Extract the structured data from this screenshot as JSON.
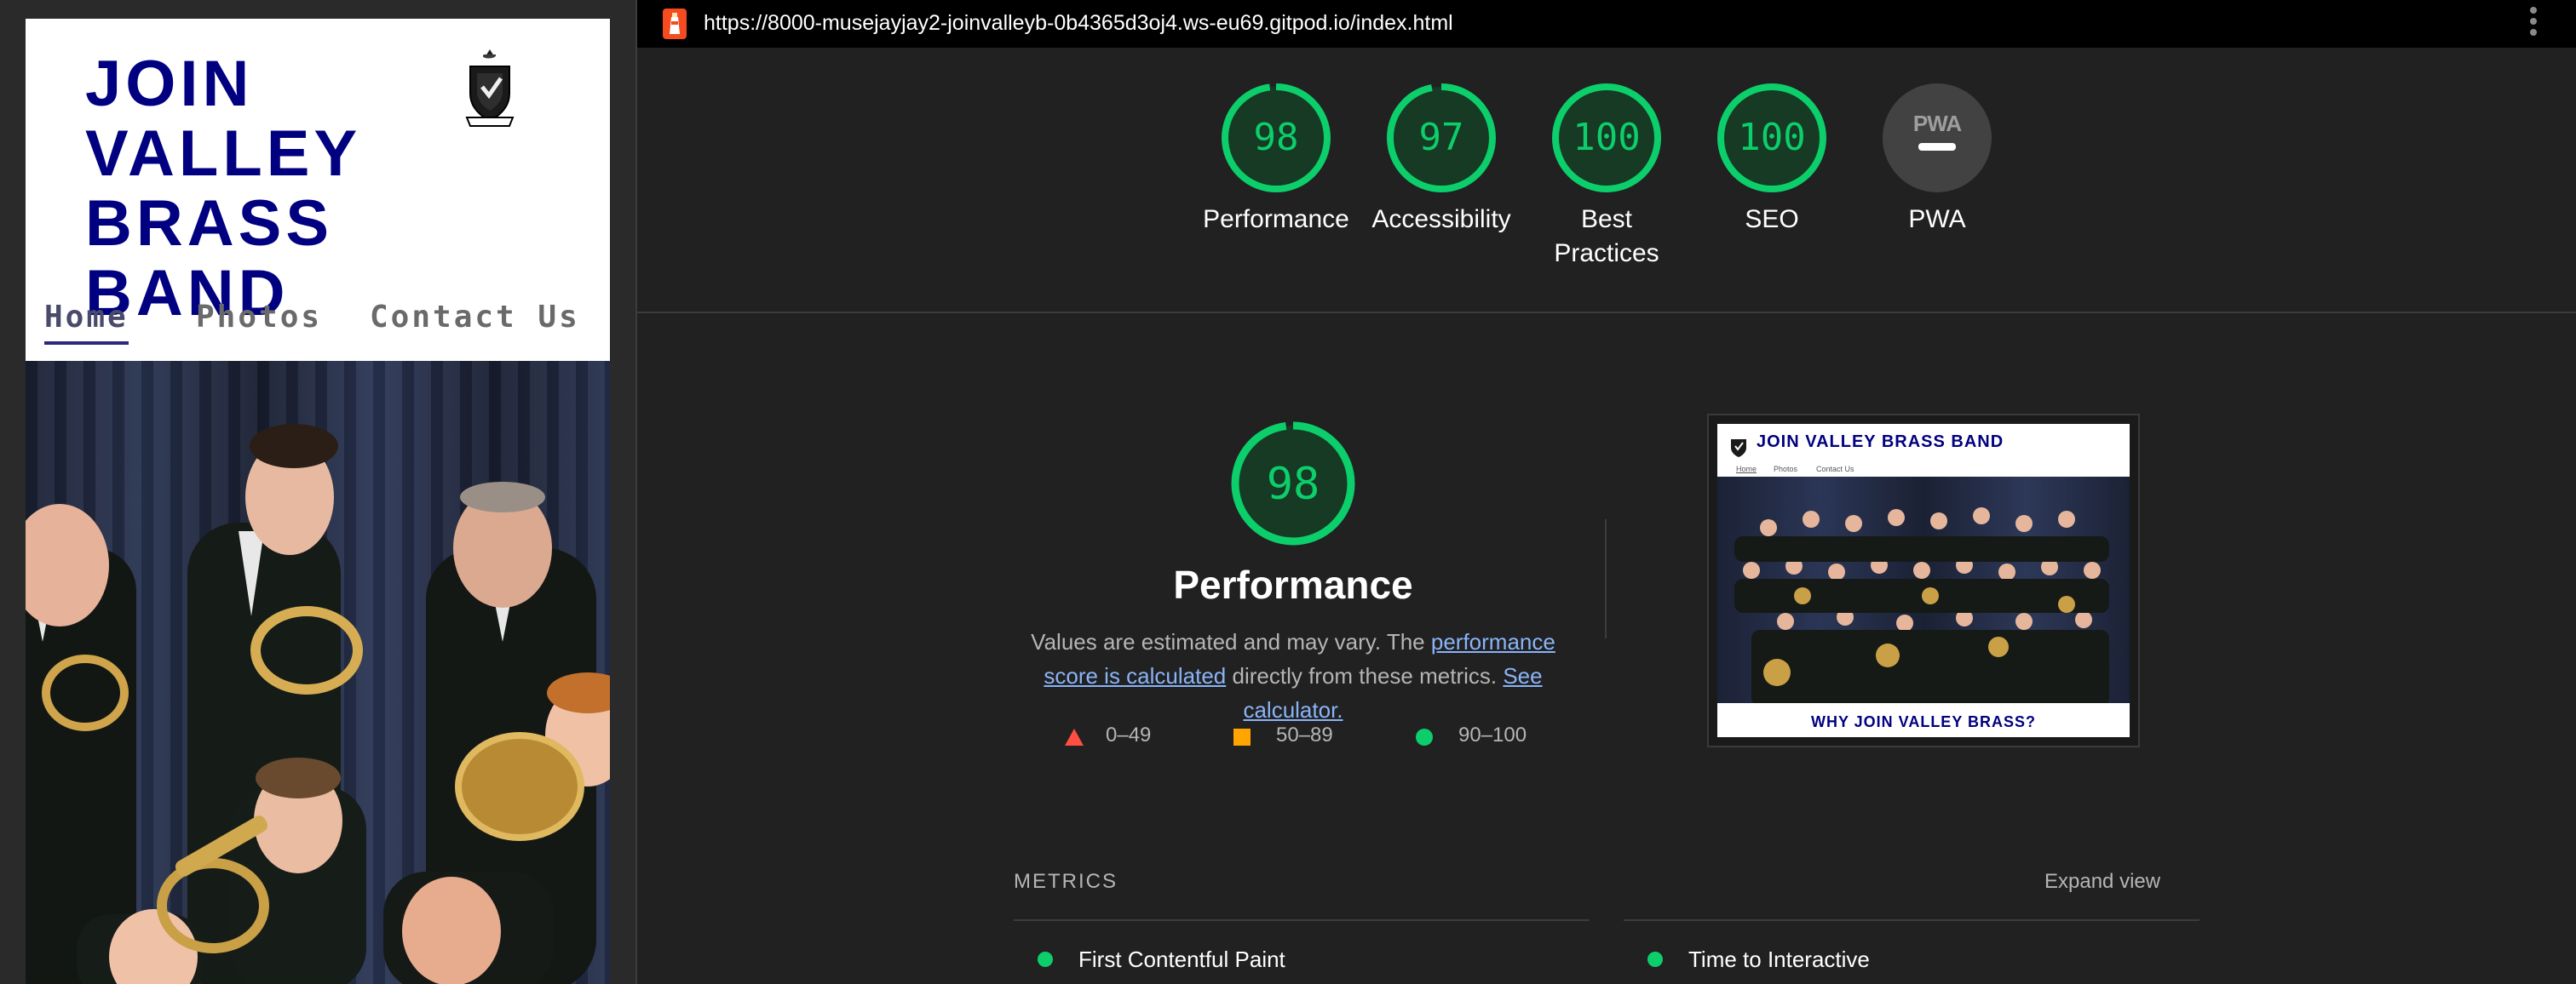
{
  "browser": {
    "url": "https://8000-musejayjay2-joinvalleyb-0b4365d3oj4.ws-eu69.gitpod.io/index.html"
  },
  "site": {
    "title": "JOIN\nVALLEY\nBRASS BAND",
    "nav": [
      {
        "label": "Home",
        "active": true
      },
      {
        "label": "Photos",
        "active": false
      },
      {
        "label": "Contact Us",
        "active": false
      }
    ]
  },
  "scores": [
    {
      "label": "Performance",
      "value": "98",
      "fraction": 0.98
    },
    {
      "label": "Accessibility",
      "value": "97",
      "fraction": 0.97
    },
    {
      "label": "Best Practices",
      "value": "100",
      "fraction": 1.0
    },
    {
      "label": "SEO",
      "value": "100",
      "fraction": 1.0
    },
    {
      "label": "PWA",
      "value": "PWA"
    }
  ],
  "performance": {
    "score": "98",
    "title": "Performance",
    "desc_1": "Values are estimated and may vary. The ",
    "link_1": "performance score is calculated",
    "desc_2": " directly from these metrics. ",
    "link_2": "See calculator."
  },
  "legend": [
    {
      "range": "0–49",
      "color": "#ff4e42",
      "shape": "triangle"
    },
    {
      "range": "50–89",
      "color": "#ffa400",
      "shape": "square"
    },
    {
      "range": "90–100",
      "color": "#0cce6b",
      "shape": "circle"
    }
  ],
  "thumbnail": {
    "title": "JOIN VALLEY BRASS BAND",
    "nav": [
      "Home",
      "Photos",
      "Contact Us"
    ],
    "cta": "WHY JOIN VALLEY BRASS?"
  },
  "metrics": {
    "heading": "METRICS",
    "expand_label": "Expand view",
    "items": [
      "First Contentful Paint",
      "Time to Interactive"
    ]
  },
  "colors": {
    "pass": "#0cce6b",
    "gauge_fill": "#163a23",
    "site_title": "#000080",
    "background": "#212121"
  }
}
